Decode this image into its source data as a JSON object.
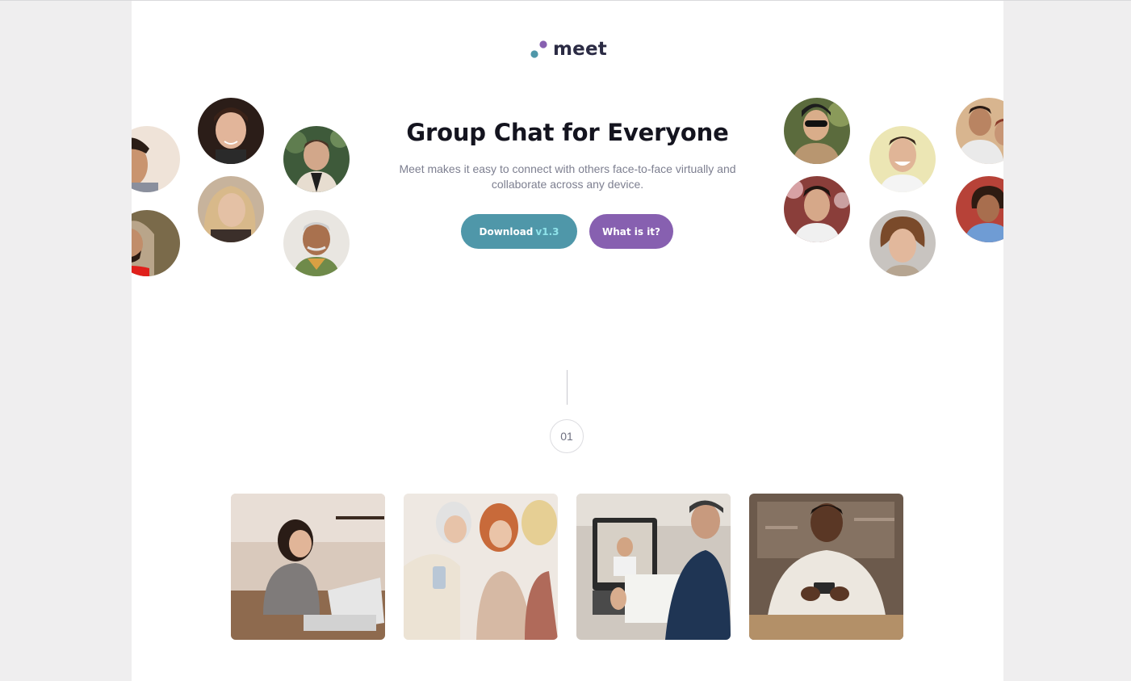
{
  "brand": {
    "name": "meet",
    "colors": {
      "teal": "#4f97a9",
      "purple": "#8760b0",
      "dark": "#2b2b44"
    }
  },
  "hero": {
    "title": "Group Chat for Everyone",
    "subtitle": "Meet makes it easy to connect with others face-to-face virtually and collaborate across any device."
  },
  "buttons": {
    "download_label": "Download",
    "download_version": "v1.3",
    "what_label": "What is it?"
  },
  "step": {
    "number": "01"
  },
  "avatars": {
    "left": [
      "person-photo",
      "person-photo",
      "person-photo",
      "person-photo",
      "person-photo",
      "person-photo"
    ],
    "right": [
      "person-photo",
      "person-photo",
      "person-photo",
      "person-photo",
      "person-photo",
      "person-photo"
    ]
  },
  "photos": [
    "woman-with-laptop-photo",
    "women-with-phone-photo",
    "video-call-photo",
    "man-with-phone-photo"
  ]
}
